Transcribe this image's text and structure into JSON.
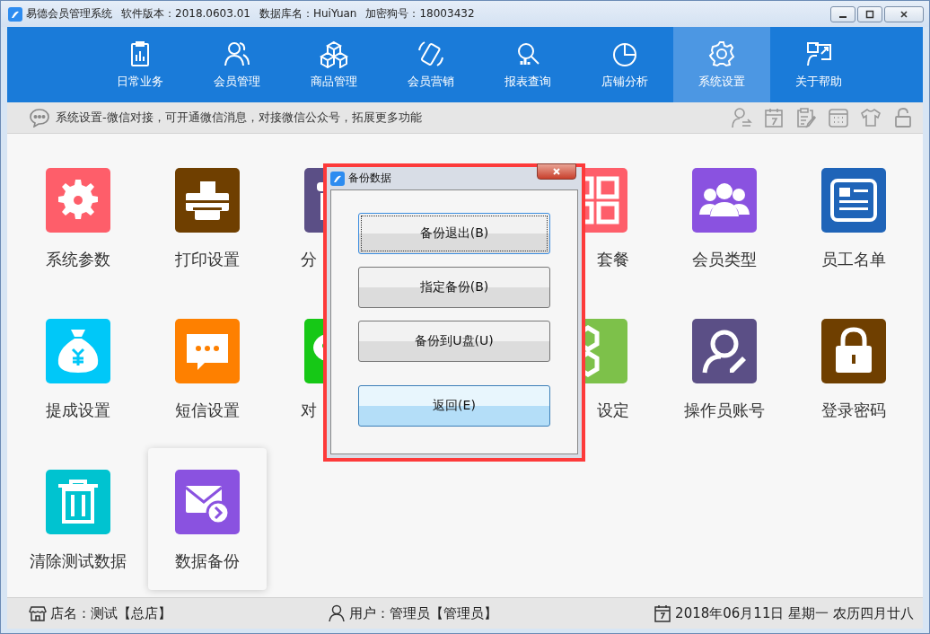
{
  "window": {
    "title": "易德会员管理系统",
    "version": "软件版本：2018.0603.01",
    "database": "数据库名：HuiYuan",
    "dongle": "加密狗号：18003432"
  },
  "nav": [
    {
      "label": "日常业务",
      "selected": false
    },
    {
      "label": "会员管理",
      "selected": false
    },
    {
      "label": "商品管理",
      "selected": false
    },
    {
      "label": "会员营销",
      "selected": false
    },
    {
      "label": "报表查询",
      "selected": false
    },
    {
      "label": "店铺分析",
      "selected": false
    },
    {
      "label": "系统设置",
      "selected": true
    },
    {
      "label": "关于帮助",
      "selected": false
    }
  ],
  "info_bar": {
    "message": "系统设置-微信对接，可开通微信消息，对接微信公众号，拓展更多功能"
  },
  "tiles": [
    [
      {
        "label": "系统参数",
        "color": "#fe5e6a",
        "selected": false
      },
      {
        "label": "打印设置",
        "color": "#6f3f00",
        "selected": false
      },
      {
        "label": "分",
        "color": "#5b4f86",
        "selected": false,
        "covered_after": true
      },
      {
        "label": "套餐",
        "color": "#fe5e6a",
        "selected": false,
        "covered_before": true
      },
      {
        "label": "会员类型",
        "color": "#8a52e0",
        "selected": false
      },
      {
        "label": "员工名单",
        "color": "#1f64b8",
        "selected": false
      }
    ],
    [
      {
        "label": "提成设置",
        "color": "#00c8f8",
        "selected": false
      },
      {
        "label": "短信设置",
        "color": "#fe8000",
        "selected": false
      },
      {
        "label": "对",
        "color": "#16c816",
        "selected": false,
        "covered_after": true
      },
      {
        "label": "设定",
        "color": "#7dc14a",
        "selected": false,
        "covered_before": true
      },
      {
        "label": "操作员账号",
        "color": "#5b4f86",
        "selected": false
      },
      {
        "label": "登录密码",
        "color": "#6f3f00",
        "selected": false
      }
    ],
    [
      {
        "label": "清除测试数据",
        "color": "#00c3d0",
        "selected": false
      },
      {
        "label": "数据备份",
        "color": "#8a52e0",
        "selected": true
      }
    ]
  ],
  "dialog": {
    "title": "备份数据",
    "buttons": [
      {
        "label": "备份退出(B)",
        "kind": "focused"
      },
      {
        "label": "指定备份(B)",
        "kind": "normal"
      },
      {
        "label": "备份到U盘(U)",
        "kind": "normal"
      },
      {
        "label": "返回(E)",
        "kind": "primary"
      }
    ]
  },
  "status_bar": {
    "store": "店名：测试【总店】",
    "user": "用户：管理员【管理员】",
    "date": "2018年06月11日 星期一 农历四月廿八"
  }
}
